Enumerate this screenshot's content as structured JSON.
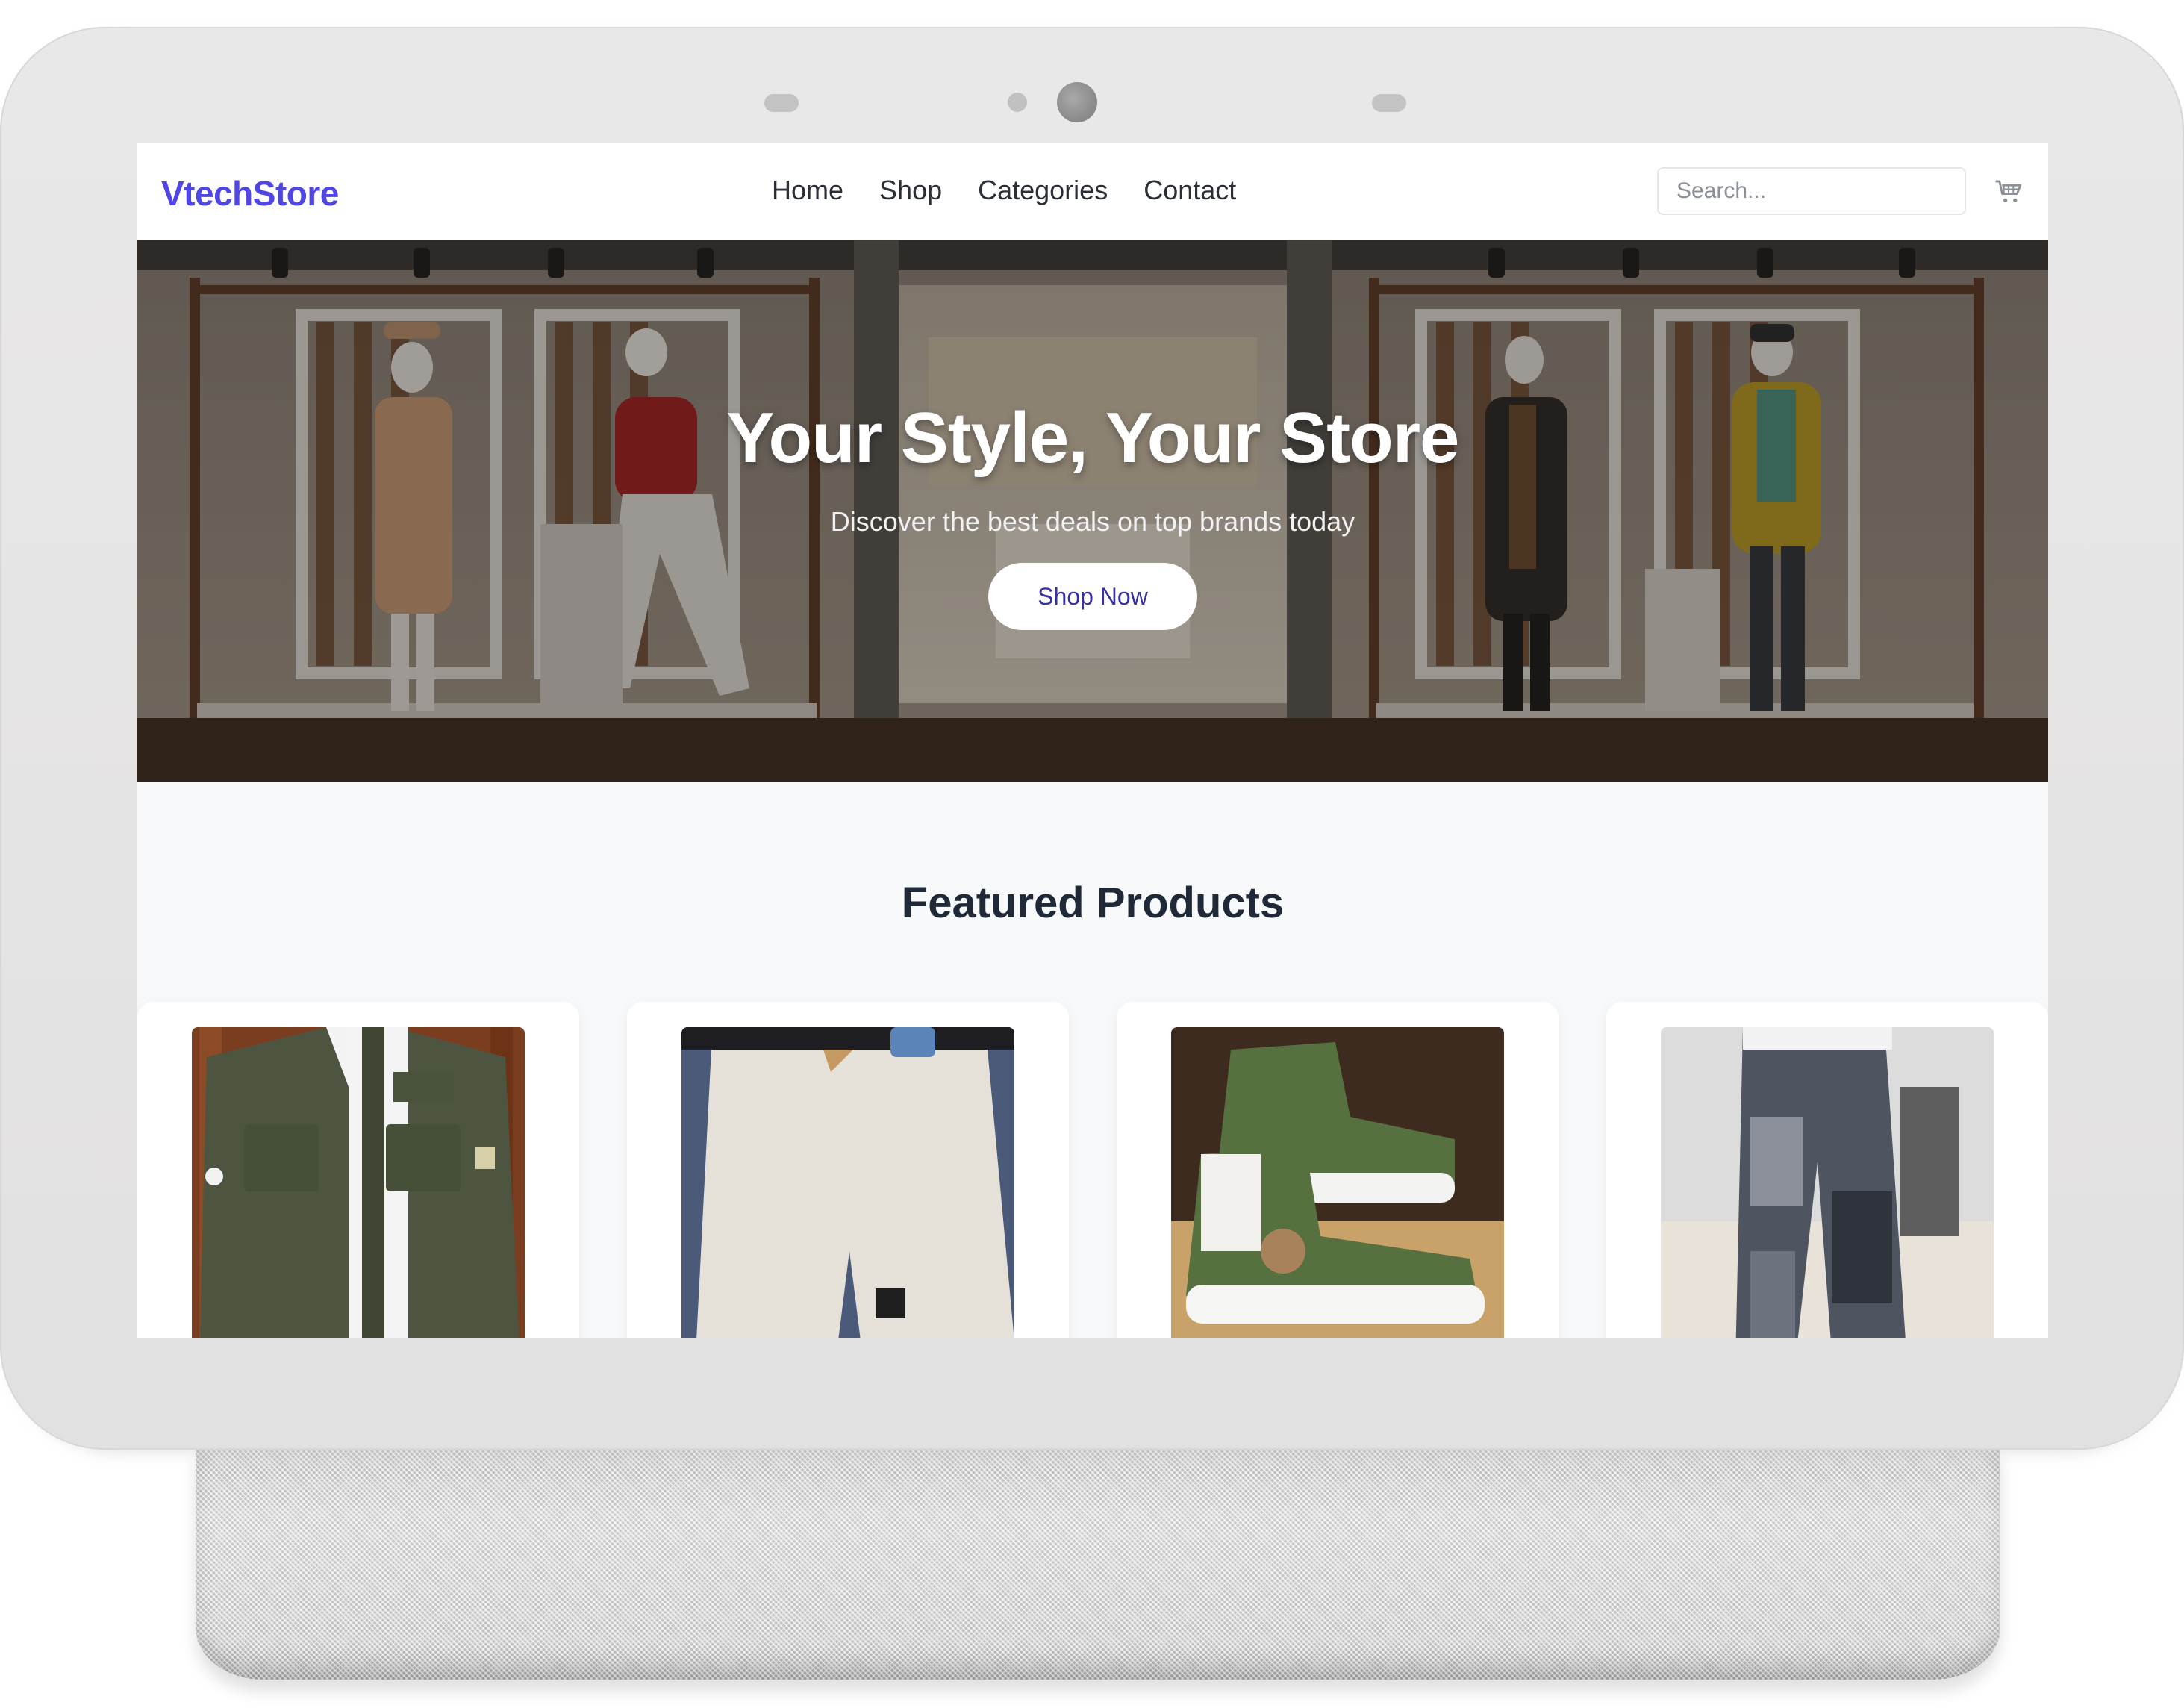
{
  "site": {
    "logo": "VtechStore"
  },
  "nav": {
    "links": [
      "Home",
      "Shop",
      "Categories",
      "Contact"
    ],
    "search_placeholder": "Search...",
    "cart_icon": "shopping-cart-icon"
  },
  "hero": {
    "title": "Your Style, Your Store",
    "subtitle": "Discover the best deals on top brands today",
    "cta": "Shop Now"
  },
  "featured": {
    "title": "Featured Products",
    "products": [
      {
        "image": "olive-green-jacket"
      },
      {
        "image": "beige-shorts"
      },
      {
        "image": "green-high-top-sneakers"
      },
      {
        "image": "patchwork-jeans"
      }
    ]
  },
  "colors": {
    "brand": "#4f46e5",
    "cta_text": "#3730a3",
    "heading": "#1f2937",
    "device_frame": "#e5e4e4"
  }
}
